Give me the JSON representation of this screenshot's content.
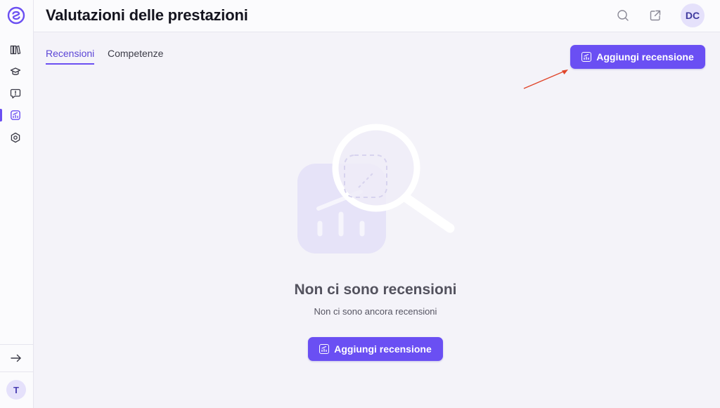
{
  "app": {
    "page_title": "Valutazioni delle prestazioni"
  },
  "sidebar": {
    "items": [
      {
        "icon": "library-icon",
        "active": false
      },
      {
        "icon": "graduation-cap-icon",
        "active": false
      },
      {
        "icon": "feedback-icon",
        "active": false
      },
      {
        "icon": "performance-chart-icon",
        "active": true
      },
      {
        "icon": "settings-hexagon-icon",
        "active": false
      }
    ],
    "user_initial": "T"
  },
  "header": {
    "user_initials": "DC"
  },
  "tabs": [
    {
      "label": "Recensioni",
      "active": true
    },
    {
      "label": "Competenze",
      "active": false
    }
  ],
  "actions": {
    "add_review_label": "Aggiungi recensione"
  },
  "empty_state": {
    "title": "Non ci sono recensioni",
    "subtitle": "Non ci sono ancora recensioni",
    "button_label": "Aggiungi recensione"
  },
  "colors": {
    "accent": "#6a4ff3",
    "background": "#f4f3f9",
    "annotation_arrow": "#e0462b"
  }
}
